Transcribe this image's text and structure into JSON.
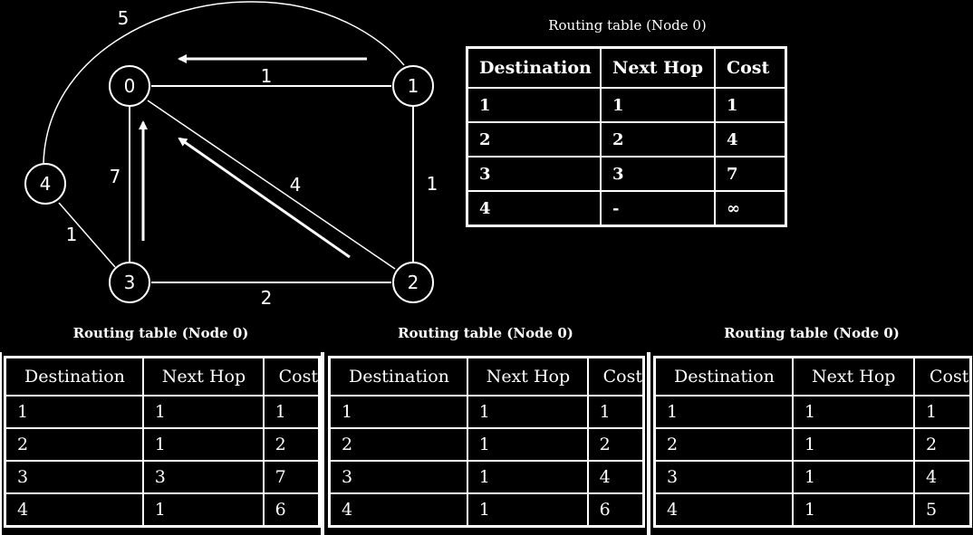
{
  "graph": {
    "nodes": [
      {
        "id": "0",
        "label": "0"
      },
      {
        "id": "1",
        "label": "1"
      },
      {
        "id": "2",
        "label": "2"
      },
      {
        "id": "3",
        "label": "3"
      },
      {
        "id": "4",
        "label": "4"
      }
    ],
    "edges": [
      {
        "from": "0",
        "to": "1",
        "weight": "1"
      },
      {
        "from": "1",
        "to": "2",
        "weight": "1"
      },
      {
        "from": "2",
        "to": "3",
        "weight": "2"
      },
      {
        "from": "0",
        "to": "3",
        "weight": "7"
      },
      {
        "from": "0",
        "to": "2",
        "weight": "4"
      },
      {
        "from": "3",
        "to": "4",
        "weight": "1"
      },
      {
        "from": "4",
        "to": "1",
        "weight": "5"
      }
    ],
    "arrows": [
      {
        "from": "1",
        "to": "0"
      },
      {
        "from": "3",
        "to": "0"
      },
      {
        "from": "2",
        "to": "0"
      }
    ]
  },
  "tables": {
    "initial": {
      "caption": "Routing table (Node 0)",
      "headers": [
        "Destination",
        "Next Hop",
        "Cost"
      ],
      "rows": [
        [
          "1",
          "1",
          "1"
        ],
        [
          "2",
          "2",
          "4"
        ],
        [
          "3",
          "3",
          "7"
        ],
        [
          "4",
          "-",
          "∞"
        ]
      ]
    },
    "step1": {
      "caption": "Routing table (Node 0)",
      "headers": [
        "Destination",
        "Next Hop",
        "Cost"
      ],
      "rows": [
        [
          "1",
          "1",
          "1"
        ],
        [
          "2",
          "1",
          "2"
        ],
        [
          "3",
          "3",
          "7"
        ],
        [
          "4",
          "1",
          "6"
        ]
      ]
    },
    "step2": {
      "caption": "Routing table (Node 0)",
      "headers": [
        "Destination",
        "Next Hop",
        "Cost"
      ],
      "rows": [
        [
          "1",
          "1",
          "1"
        ],
        [
          "2",
          "1",
          "2"
        ],
        [
          "3",
          "1",
          "4"
        ],
        [
          "4",
          "1",
          "6"
        ]
      ]
    },
    "step3": {
      "caption": "Routing table (Node 0)",
      "headers": [
        "Destination",
        "Next Hop",
        "Cost"
      ],
      "rows": [
        [
          "1",
          "1",
          "1"
        ],
        [
          "2",
          "1",
          "2"
        ],
        [
          "3",
          "1",
          "4"
        ],
        [
          "4",
          "1",
          "5"
        ]
      ]
    }
  }
}
